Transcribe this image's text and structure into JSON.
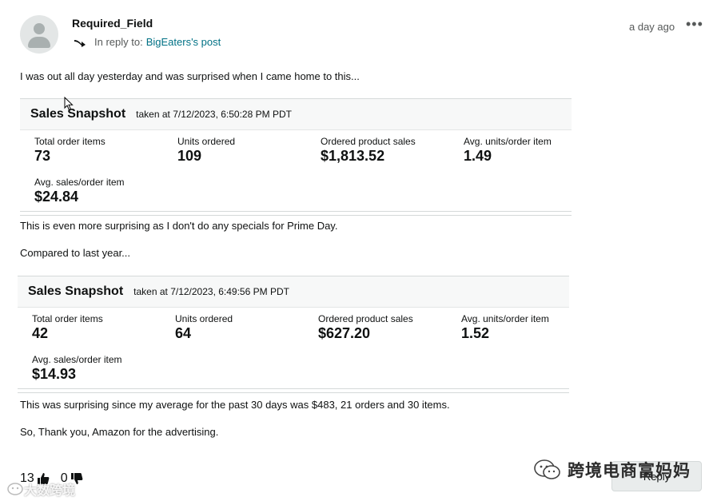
{
  "post": {
    "author": "Required_Field",
    "reply_prefix": "In reply to:",
    "reply_target": "BigEaters's post",
    "timestamp": "a day ago",
    "more_label": "•••"
  },
  "paragraphs": {
    "p1": "I was out all day yesterday and was surprised when I came home to this...",
    "p2": "This is even more surprising as I don't do any specials for Prime Day.",
    "p3": "Compared to last year...",
    "p4": "This was surprising since my average for the past 30 days was $483, 21 orders and 30 items.",
    "p5": "So, Thank you, Amazon for the advertising."
  },
  "snapshots": [
    {
      "title": "Sales Snapshot",
      "taken": "taken at 7/12/2023, 6:50:28 PM PDT",
      "metrics": [
        {
          "label": "Total order items",
          "value": "73"
        },
        {
          "label": "Units ordered",
          "value": "109"
        },
        {
          "label": "Ordered product sales",
          "value": "$1,813.52"
        },
        {
          "label": "Avg. units/order item",
          "value": "1.49"
        },
        {
          "label": "Avg. sales/order item",
          "value": "$24.84"
        }
      ]
    },
    {
      "title": "Sales Snapshot",
      "taken": "taken at 7/12/2023, 6:49:56 PM PDT",
      "metrics": [
        {
          "label": "Total order items",
          "value": "42"
        },
        {
          "label": "Units ordered",
          "value": "64"
        },
        {
          "label": "Ordered product sales",
          "value": "$627.20"
        },
        {
          "label": "Avg. units/order item",
          "value": "1.52"
        },
        {
          "label": "Avg. sales/order item",
          "value": "$14.93"
        }
      ]
    }
  ],
  "footer": {
    "upvotes": "13",
    "downvotes": "0",
    "reply_label": "Reply"
  },
  "watermarks": {
    "wechat_account": "跨境电商富妈妈",
    "corner": "大数跨境"
  }
}
